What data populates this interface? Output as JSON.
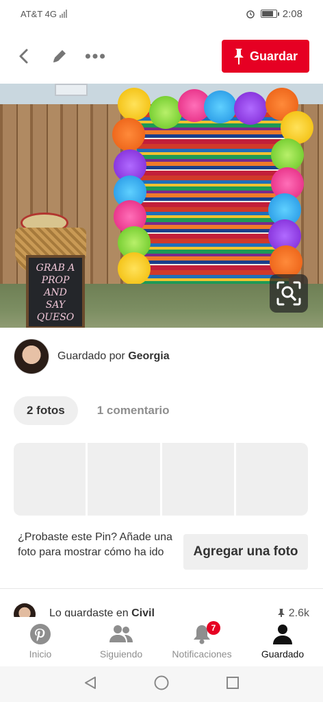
{
  "status_bar": {
    "carrier": "AT&T 4G",
    "network_tag": "4G",
    "time": "2:08"
  },
  "toolbar": {
    "back_icon": "chevron-left-icon",
    "edit_icon": "pencil-icon",
    "more_icon": "more-horizontal-icon",
    "save_label": "Guardar",
    "save_color": "#e60023"
  },
  "pin": {
    "chalkboard_lines": [
      "GRAB A",
      "PROP AND",
      "SAY",
      "QUESO"
    ],
    "lens_icon": "visual-search-icon"
  },
  "saved_by": {
    "prefix": "Guardado por",
    "name": "Georgia"
  },
  "tabs": [
    {
      "label": "2 fotos",
      "active": true
    },
    {
      "label": "1 comentario",
      "active": false
    }
  ],
  "tried": {
    "prompt": "¿Probaste este Pin? Añade una foto para mostrar cómo ha ido",
    "button_label": "Agregar una foto"
  },
  "partial_row": {
    "prefix": "Lo guardaste en",
    "board": "Civil",
    "count": "2.6k"
  },
  "bottom_nav": [
    {
      "label": "Inicio",
      "icon": "pinterest-logo-icon",
      "active": false
    },
    {
      "label": "Siguiendo",
      "icon": "people-icon",
      "active": false
    },
    {
      "label": "Notificaciones",
      "icon": "bell-icon",
      "active": false,
      "badge": "7"
    },
    {
      "label": "Guardado",
      "icon": "profile-icon",
      "active": true
    }
  ]
}
